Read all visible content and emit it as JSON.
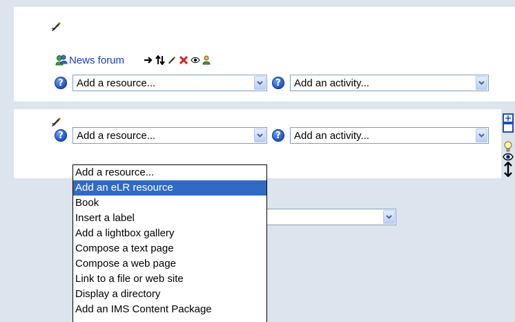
{
  "section1": {
    "news_forum_label": "News forum",
    "add_resource_value": "Add a resource...",
    "add_activity_value": "Add an activity..."
  },
  "section2": {
    "add_resource_value": "Add a resource...",
    "add_activity_value": "Add an activity..."
  },
  "help_glyph": "?",
  "resource_dropdown": {
    "options": [
      "Add a resource...",
      "Add an eLR resource",
      "Book",
      "Insert a label",
      "Add a lightbox gallery",
      "Compose a text page",
      "Compose a web page",
      "Link to a file or web site",
      "Display a directory",
      "Add an IMS Content Package"
    ],
    "highlighted": "Add an eLR resource"
  },
  "colors": {
    "page_bg": "#dce4ee",
    "link": "#1a3ccf",
    "highlight": "#316ac5"
  },
  "icons": {
    "section_edit": "edit-pencil-icon",
    "forum": "group-people-icon",
    "move_right": "arrow-right-icon",
    "move": "move-updown-icon",
    "edit": "edit-pencil-icon",
    "delete": "delete-x-icon",
    "visibility": "eye-icon",
    "roles": "person-icon",
    "help": "help-icon",
    "section_toggle": "show-section-icon",
    "highlight": "lightbulb-icon",
    "section_visibility": "eye-icon",
    "section_move": "move-updown-icon"
  }
}
